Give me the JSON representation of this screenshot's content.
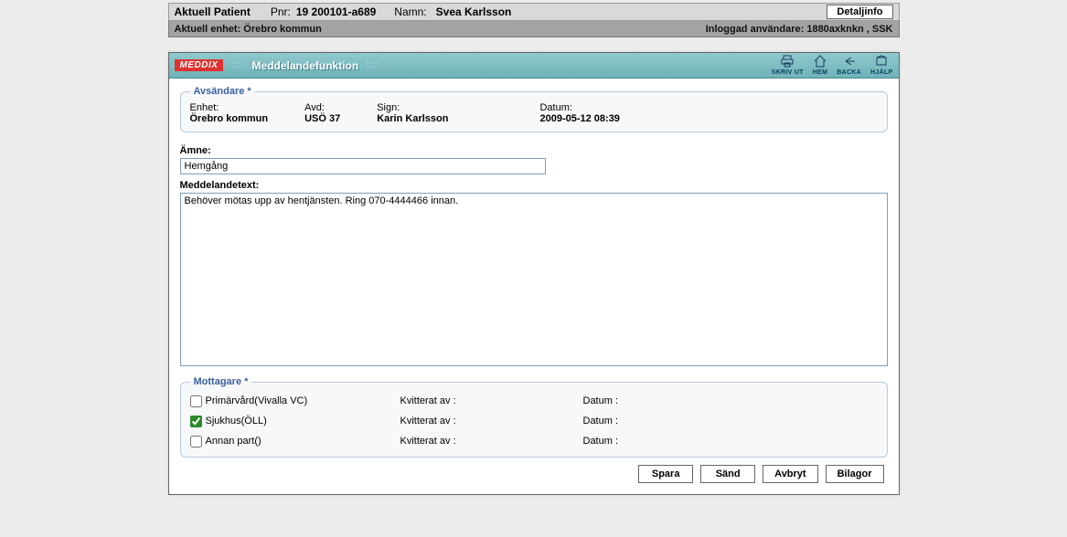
{
  "patientBar": {
    "title": "Aktuell Patient",
    "pnrLabel": "Pnr:",
    "pnr": "19 200101-a689",
    "nameLabel": "Namn:",
    "name": "Svea Karlsson",
    "detailBtn": "Detaljinfo"
  },
  "unitBar": {
    "left": "Aktuell enhet: Örebro kommun",
    "right": "Inloggad användare: 1880axknkn , SSK"
  },
  "window": {
    "brand": "MEDDIX",
    "title": "Meddelandefunktion",
    "toolbar": {
      "print": "SKRIV UT",
      "home": "HEM",
      "back": "BACKA",
      "help": "HJÄLP"
    }
  },
  "sender": {
    "legend": "Avsändare *",
    "unitLabel": "Enhet:",
    "unit": "Örebro kommun",
    "deptLabel": "Avd:",
    "dept": "USÖ 37",
    "signLabel": "Sign:",
    "sign": "Karin Karlsson",
    "dateLabel": "Datum:",
    "date": "2009-05-12 08:39"
  },
  "form": {
    "subjectLabel": "Ämne:",
    "subject": "Hemgång",
    "messageLabel": "Meddelandetext:",
    "message": "Behöver mötas upp av hentjänsten. Ring 070-4444466 innan."
  },
  "recipients": {
    "legend": "Mottagare *",
    "kvitLabel": "Kvitterat av :",
    "datumLabel": "Datum :",
    "rows": [
      {
        "label": "Primärvård(Vivalla VC)",
        "checked": false
      },
      {
        "label": "Sjukhus(ÖLL)",
        "checked": true
      },
      {
        "label": "Annan part()",
        "checked": false
      }
    ]
  },
  "buttons": {
    "save": "Spara",
    "send": "Sänd",
    "cancel": "Avbryt",
    "attach": "Bilagor"
  }
}
